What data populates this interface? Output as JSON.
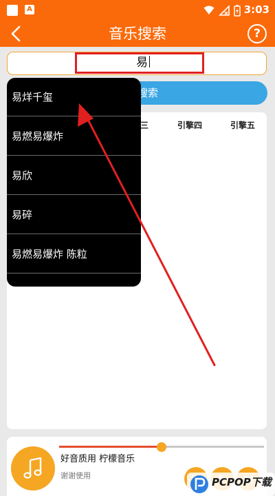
{
  "status_bar": {
    "time": "3:03"
  },
  "header": {
    "title": "音乐搜索",
    "help_label": "?"
  },
  "search": {
    "value": "易"
  },
  "search_button": {
    "label": "搜索"
  },
  "engine_tabs": [
    "三",
    "引擎四",
    "引擎五"
  ],
  "suggestions": [
    "易烊千玺",
    "易燃易爆炸",
    "易欣",
    "易碎",
    "易燃易爆炸 陈粒"
  ],
  "player": {
    "title": "好音质用 柠檬音乐",
    "subtitle": "谢谢使用",
    "progress_percent": 50
  },
  "watermark": {
    "text": "PCPOP下载"
  },
  "colors": {
    "primary": "#fb6a0a",
    "accent": "#3aa6e4",
    "highlight": "#e02020",
    "player_accent": "#f5a623"
  }
}
